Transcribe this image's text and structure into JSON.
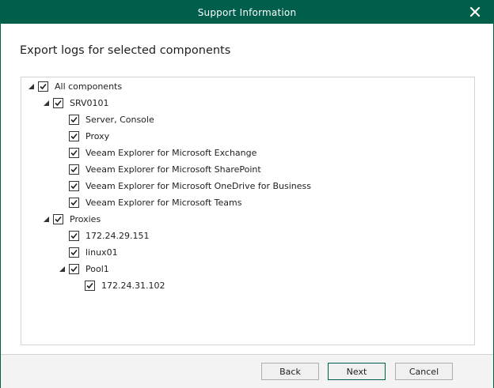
{
  "window": {
    "title": "Support Information"
  },
  "heading": "Export logs for selected components",
  "tree": {
    "root": "All components",
    "server": "SRV0101",
    "server_items": [
      "Server, Console",
      "Proxy",
      "Veeam Explorer for Microsoft Exchange",
      "Veeam Explorer for Microsoft SharePoint",
      "Veeam Explorer for Microsoft OneDrive for Business",
      "Veeam Explorer for Microsoft Teams"
    ],
    "proxies": "Proxies",
    "proxy_items": [
      "172.24.29.151",
      "linux01"
    ],
    "pool": "Pool1",
    "pool_items": [
      "172.24.31.102"
    ]
  },
  "buttons": {
    "back": "Back",
    "next": "Next",
    "cancel": "Cancel"
  },
  "colors": {
    "titlebar": "#005f4b",
    "accent": "#005f4b"
  }
}
